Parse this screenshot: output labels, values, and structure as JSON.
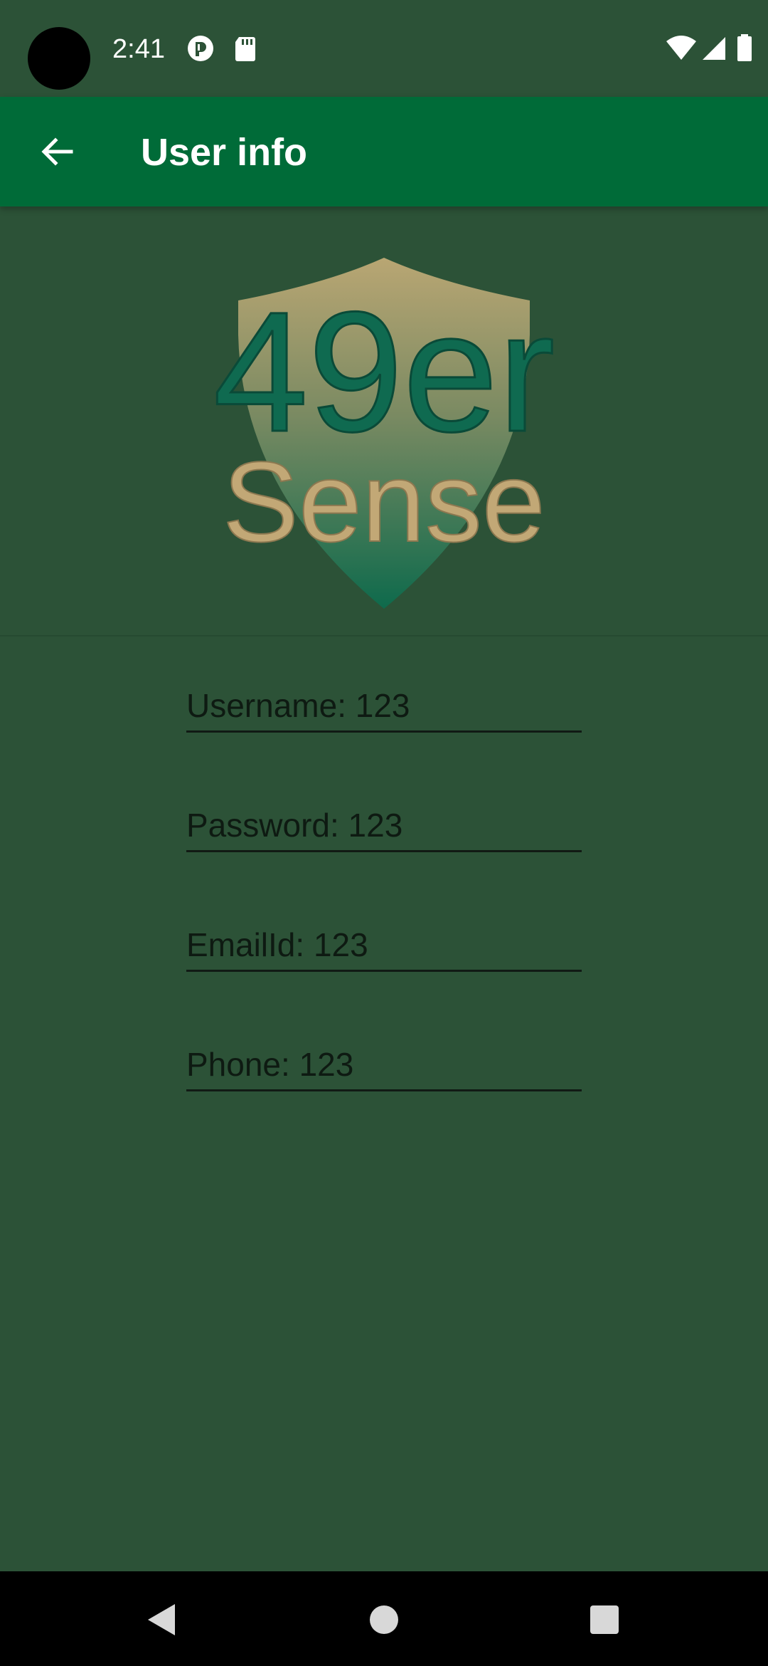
{
  "status_bar": {
    "time": "2:41",
    "icons": [
      "app-notification-icon",
      "sd-card-icon",
      "wifi-icon",
      "cellular-signal-icon",
      "battery-icon"
    ]
  },
  "app_bar": {
    "back_icon": "arrow-back-icon",
    "title": "User info"
  },
  "logo": {
    "line1": "49er",
    "line2": "Sense"
  },
  "fields": {
    "username": "Username: 123",
    "password": "Password: 123",
    "email": "EmailId: 123",
    "phone": "Phone: 123"
  },
  "nav_bar": {
    "back": "nav-back-icon",
    "home": "nav-home-icon",
    "recents": "nav-recents-icon"
  },
  "colors": {
    "background": "#2c5237",
    "app_bar": "#006b38",
    "logo_green": "#0f6a50",
    "logo_gold": "#c2a876"
  }
}
